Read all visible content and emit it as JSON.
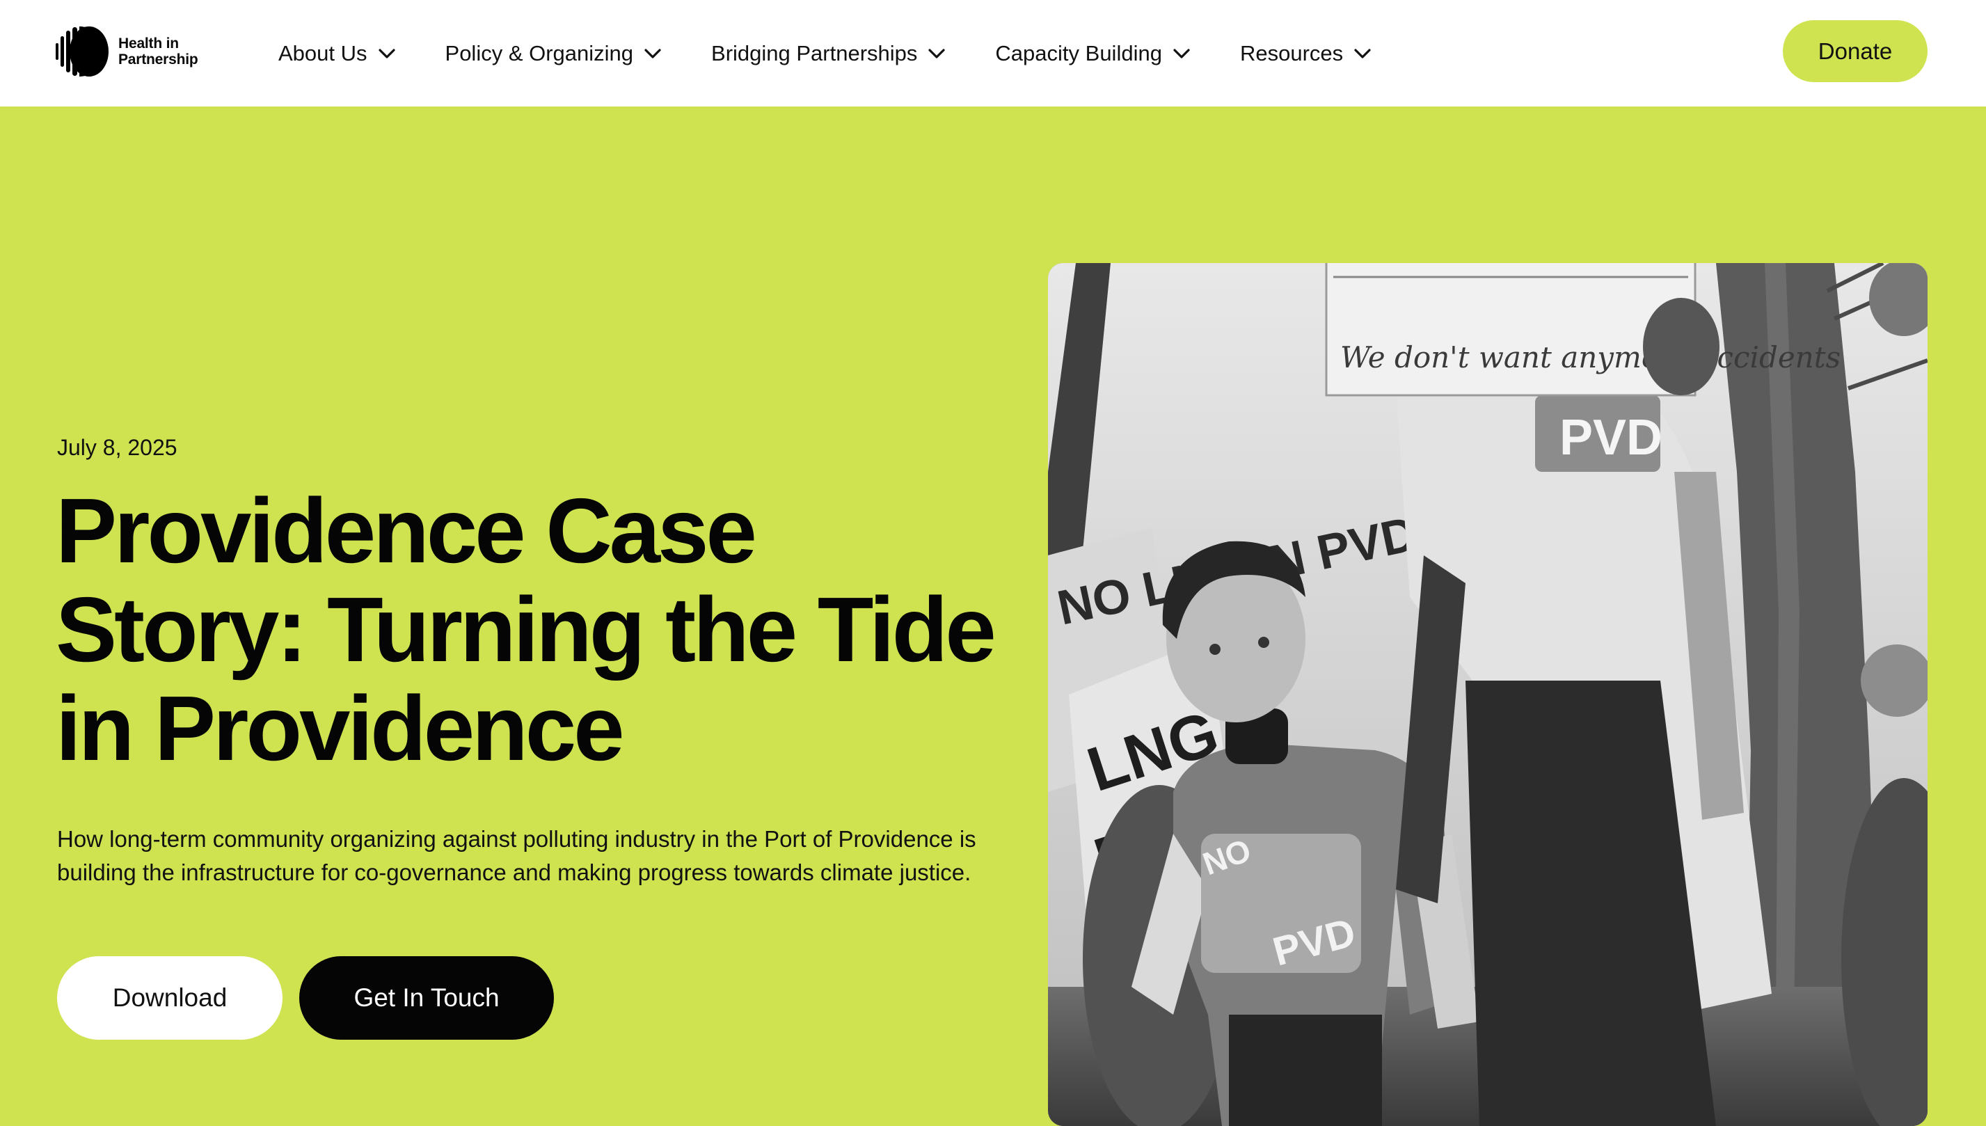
{
  "header": {
    "logo_lines": [
      "Health in",
      "Partnership"
    ],
    "nav": [
      {
        "label": "About Us"
      },
      {
        "label": "Policy & Organizing"
      },
      {
        "label": "Bridging Partnerships"
      },
      {
        "label": "Capacity Building"
      },
      {
        "label": "Resources"
      }
    ],
    "donate_label": "Donate"
  },
  "hero": {
    "date": "July 8, 2025",
    "title": "Providence Case Story: Turning the Tide in Providence",
    "description": "How long-term community organizing against polluting industry in the Port of Providence is building the infrastructure for co-governance and making progress towards climate justice.",
    "download_label": "Download",
    "contact_label": "Get In Touch",
    "photo": {
      "alt": "Black-and-white photo of children at a protest holding signs",
      "sign_text": "We don't want anymore accidents",
      "shirt_text": "PVD",
      "placard_text": "NO LNG IN PVD"
    }
  },
  "colors": {
    "accent": "#cfe350",
    "dark": "#050505",
    "white": "#ffffff"
  }
}
